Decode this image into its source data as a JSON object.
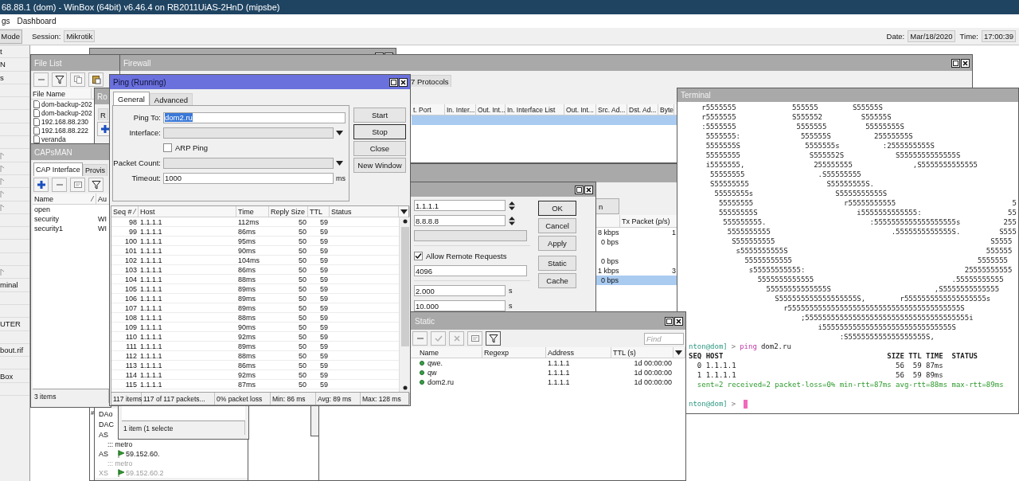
{
  "window": {
    "title": "68.88.1 (dom) - WinBox (64bit) v6.46.4 on RB2011UiAS-2HnD (mipsbe)"
  },
  "menu": [
    {
      "label": "gs"
    },
    {
      "label": "Dashboard"
    }
  ],
  "toolbar": {
    "mode_button": "Mode",
    "session_label": "Session:",
    "session": "Mikrotik",
    "date_label": "Date:",
    "date": "Mar/18/2020",
    "time_label": "Time:",
    "time": "17:00:39"
  },
  "sidebar": {
    "items": [
      {
        "label": "t",
        "submenu": false
      },
      {
        "label": "N",
        "submenu": false
      },
      {
        "label": "s",
        "submenu": false
      },
      {
        "submenu": false
      },
      {
        "submenu": false
      },
      {
        "submenu": false
      },
      {
        "submenu": false
      },
      {
        "submenu": false
      },
      {
        "submenu": true
      },
      {
        "submenu": true
      },
      {
        "submenu": true
      },
      {
        "submenu": true
      },
      {
        "submenu": true
      },
      {
        "submenu": false
      },
      {
        "submenu": false
      },
      {
        "submenu": false
      },
      {
        "submenu": false
      },
      {
        "submenu": true
      },
      {
        "label": "minal",
        "submenu": false
      },
      {
        "submenu": false
      },
      {
        "submenu": false
      },
      {
        "label": "UTER",
        "submenu": false
      },
      {
        "submenu": false
      },
      {
        "label": "bout.rif",
        "submenu": false
      },
      {
        "submenu": false
      },
      {
        "label": "Box",
        "submenu": false
      },
      {
        "submenu": false
      }
    ]
  },
  "back_window": {
    "column_1": "#"
  },
  "file_list": {
    "title": "File List",
    "column": "File Name",
    "rows": [
      "dom-backup-202",
      "dom-backup-202",
      "192.168.88.230",
      "192.168.88.222",
      "veranda"
    ]
  },
  "firewall": {
    "title": "Firewall",
    "tabs": [
      {
        "label": "7 Protocols",
        "selected": false
      }
    ],
    "columns": [
      "t. Port",
      "In. Inter...",
      "Out. Int...",
      "In. Interface List",
      "Out. Int...",
      "Src. Ad...",
      "Dst. Ad...",
      "Byte"
    ],
    "rows": [
      {
        "selected": true
      }
    ]
  },
  "interface_list": {
    "button": "n",
    "columns": [
      "Tx Packet (p/s)"
    ],
    "rows": [
      {
        "column_1": "8 kbps",
        "column_2": "1",
        "selected": false
      },
      {
        "column_1": "0 bps",
        "selected": false
      },
      {
        "selected": false
      },
      {
        "column_1": "0 bps",
        "selected": false
      },
      {
        "column_1": "1 kbps",
        "column_2": "3",
        "selected": false
      },
      {
        "column_1": "0 bps",
        "selected": true
      }
    ]
  },
  "route_list": {
    "title": "Ro",
    "tab": "R",
    "rows": [
      {
        "kind": "route",
        "type": "DAo",
        "disabled": false
      },
      {
        "kind": "route",
        "type": "DAC",
        "disabled": false
      },
      {
        "kind": "route",
        "type": "AS",
        "disabled": false
      },
      {
        "kind": "comment",
        "text": "::: metro",
        "disabled": false
      },
      {
        "kind": "route",
        "type": "AS",
        "destination": "59.152.60.",
        "disabled": false
      },
      {
        "kind": "comment",
        "text": "::: metro",
        "disabled": true
      },
      {
        "kind": "route",
        "type": "XS",
        "destination": "59.152.60.2",
        "disabled": true
      }
    ]
  },
  "selection_window": {
    "status": "1 item (1 selecte"
  },
  "capsman": {
    "title": "CAPsMAN",
    "tabs": [
      {
        "label": "CAP Interface",
        "selected": true
      },
      {
        "label": "Provis",
        "selected": false
      }
    ],
    "columns": [
      "Name",
      "Au"
    ],
    "rows": [
      {
        "name": "open"
      },
      {
        "name": "security",
        "column_2": "WI"
      },
      {
        "name": "security1",
        "column_2": "WI"
      }
    ],
    "status": "3 items"
  },
  "dns_settings": {
    "servers": [
      "1.1.1.1",
      "8.8.8.8"
    ],
    "allow_remote_requests": {
      "label": "Allow Remote Requests",
      "checked": true
    },
    "cache_size": "4096",
    "timeouts": [
      {
        "value": "2.000",
        "unit": "s"
      },
      {
        "value": "10.000",
        "unit": "s"
      }
    ],
    "buttons": [
      {
        "label": "OK",
        "focused": true
      },
      {
        "label": "Cancel",
        "focused": false
      },
      {
        "label": "Apply",
        "focused": false
      },
      {
        "label": "Static",
        "focused": false
      },
      {
        "label": "Cache",
        "focused": false
      }
    ]
  },
  "terminal": {
    "title": "Terminal",
    "art": [
      "   r5555555             555555        S55555S",
      "   r5555555             S555552         S55555S",
      "   :5555555              5555555         55555555S",
      "    5555555:              555555S          25555555S",
      "    5555555S               5555555s          :2555555555S",
      "    55555555                S555552S            S5555555555555S",
      "    i5555555,                255555555              ,S5555555555555",
      "     55555555                 .S55555555",
      "     S55555555                  S55555555S.",
      "      55555555s                   S5555555555S",
      "       55555555                     r55555555555                           5",
      "       55555555S                       i5555555555555:                    55",
      "        555555555.                        :5555555555555555555s          255",
      "         5555555555                            .5555555555555S.         S555",
      "          S555555555                                                  S5555",
      "           s5555555555S                                              555555",
      "             55555555555                                           5555555",
      "              s55555555555:                                     25555555555",
      "                5555555555555                                .55555555555",
      "                  55555555555555S                        ,S5555555555555",
      "                    S555555555555555555S,        r5555555555555555555s",
      "                      r5555555555555555555555555555555555555555S",
      "                          ;55555555555555555555555555555555555555i",
      "                              i555555555555555555555555555555S",
      "                                   :S555555555555555555S,"
    ],
    "command": {
      "user": "nton@dom]",
      "sign": ">",
      "command": "ping",
      "argument": "dom2.ru"
    },
    "header": "SEQ HOST                                      SIZE TTL TIME  STATUS",
    "results": [
      "  0 1.1.1.1                                     56  59 87ms",
      "  1 1.1.1.1                                     56  59 89ms"
    ],
    "summary": "  sent=2 received=2 packet-loss=0% min-rtt=87ms avg-rtt=88ms max-rtt=89ms",
    "prompt": {
      "user": "nton@dom]",
      "sign": ">"
    }
  },
  "dns_static": {
    "title": "Static",
    "find_placeholder": "Find",
    "columns": [
      "Name",
      "Regexp",
      "Address",
      "TTL (s)"
    ],
    "rows": [
      {
        "name": "qwe.",
        "address": "1.1.1.1",
        "ttl": "1d 00:00:00"
      },
      {
        "name": "qw",
        "address": "1.1.1.1",
        "ttl": "1d 00:00:00"
      },
      {
        "name": "dom2.ru",
        "address": "1.1.1.1",
        "ttl": "1d 00:00:00"
      }
    ]
  },
  "ping": {
    "title": "Ping (Running)",
    "active": true,
    "tabs": [
      {
        "label": "General",
        "selected": true
      },
      {
        "label": "Advanced",
        "selected": false
      }
    ],
    "fields": [
      {
        "kind": "text",
        "label": "Ping To:",
        "value": "dom2.ru",
        "highlighted": true
      },
      {
        "kind": "dropdown",
        "label": "Interface:",
        "disabled": true
      },
      {
        "kind": "checkbox",
        "label": "ARP Ping",
        "checked": false
      },
      {
        "kind": "dropdown",
        "label": "Packet Count:",
        "disabled": true
      },
      {
        "kind": "text",
        "label": "Timeout:",
        "value": "1000",
        "unit": "ms",
        "highlighted": false
      }
    ],
    "buttons": [
      {
        "label": "Start",
        "focused": false
      },
      {
        "label": "Stop",
        "focused": true
      },
      {
        "label": "Close",
        "focused": false
      },
      {
        "label": "New Window",
        "focused": false
      }
    ],
    "columns": [
      "Seq #",
      "Host",
      "Time",
      "Reply Size",
      "TTL",
      "Status"
    ],
    "rows": [
      {
        "seq": "98",
        "host": "1.1.1.1",
        "time": "112ms",
        "size": "50",
        "ttl": "59"
      },
      {
        "seq": "99",
        "host": "1.1.1.1",
        "time": "86ms",
        "size": "50",
        "ttl": "59"
      },
      {
        "seq": "100",
        "host": "1.1.1.1",
        "time": "95ms",
        "size": "50",
        "ttl": "59"
      },
      {
        "seq": "101",
        "host": "1.1.1.1",
        "time": "90ms",
        "size": "50",
        "ttl": "59"
      },
      {
        "seq": "102",
        "host": "1.1.1.1",
        "time": "104ms",
        "size": "50",
        "ttl": "59"
      },
      {
        "seq": "103",
        "host": "1.1.1.1",
        "time": "86ms",
        "size": "50",
        "ttl": "59"
      },
      {
        "seq": "104",
        "host": "1.1.1.1",
        "time": "88ms",
        "size": "50",
        "ttl": "59"
      },
      {
        "seq": "105",
        "host": "1.1.1.1",
        "time": "89ms",
        "size": "50",
        "ttl": "59"
      },
      {
        "seq": "106",
        "host": "1.1.1.1",
        "time": "89ms",
        "size": "50",
        "ttl": "59"
      },
      {
        "seq": "107",
        "host": "1.1.1.1",
        "time": "89ms",
        "size": "50",
        "ttl": "59"
      },
      {
        "seq": "108",
        "host": "1.1.1.1",
        "time": "88ms",
        "size": "50",
        "ttl": "59"
      },
      {
        "seq": "109",
        "host": "1.1.1.1",
        "time": "90ms",
        "size": "50",
        "ttl": "59"
      },
      {
        "seq": "110",
        "host": "1.1.1.1",
        "time": "92ms",
        "size": "50",
        "ttl": "59"
      },
      {
        "seq": "111",
        "host": "1.1.1.1",
        "time": "89ms",
        "size": "50",
        "ttl": "59"
      },
      {
        "seq": "112",
        "host": "1.1.1.1",
        "time": "88ms",
        "size": "50",
        "ttl": "59"
      },
      {
        "seq": "113",
        "host": "1.1.1.1",
        "time": "86ms",
        "size": "50",
        "ttl": "59"
      },
      {
        "seq": "114",
        "host": "1.1.1.1",
        "time": "92ms",
        "size": "50",
        "ttl": "59"
      },
      {
        "seq": "115",
        "host": "1.1.1.1",
        "time": "87ms",
        "size": "50",
        "ttl": "59"
      }
    ],
    "status": [
      "117 items",
      "117 of 117 packets...",
      "0% packet loss",
      "Min: 86 ms",
      "Avg: 89 ms",
      "Max: 128 ms"
    ]
  }
}
